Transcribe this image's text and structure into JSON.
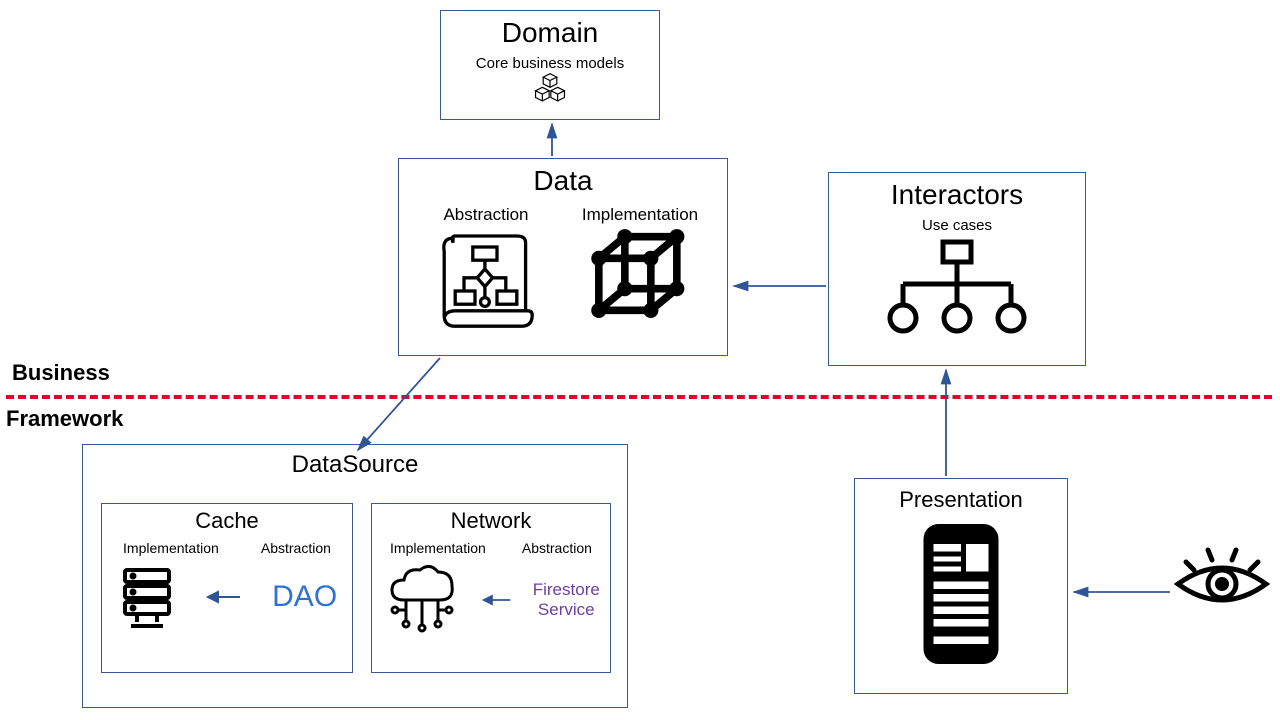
{
  "labels": {
    "business": "Business",
    "framework": "Framework"
  },
  "boxes": {
    "domain": {
      "title": "Domain",
      "subtitle": "Core business models"
    },
    "data": {
      "title": "Data",
      "abstraction": "Abstraction",
      "implementation": "Implementation"
    },
    "interactors": {
      "title": "Interactors",
      "subtitle": "Use cases"
    },
    "datasource": {
      "title": "DataSource",
      "cache": {
        "title": "Cache",
        "implementation": "Implementation",
        "abstraction": "Abstraction",
        "abstraction_text": "DAO"
      },
      "network": {
        "title": "Network",
        "implementation": "Implementation",
        "abstraction": "Abstraction",
        "abstraction_text": "Firestore\nService"
      }
    },
    "presentation": {
      "title": "Presentation"
    }
  },
  "arrows": [
    {
      "from": "data",
      "to": "domain"
    },
    {
      "from": "interactors",
      "to": "data"
    },
    {
      "from": "data",
      "to": "datasource"
    },
    {
      "from": "presentation",
      "to": "interactors"
    },
    {
      "from": "user-eye",
      "to": "presentation"
    },
    {
      "from": "cache.abstraction",
      "to": "cache.implementation"
    },
    {
      "from": "network.abstraction",
      "to": "network.implementation"
    }
  ]
}
